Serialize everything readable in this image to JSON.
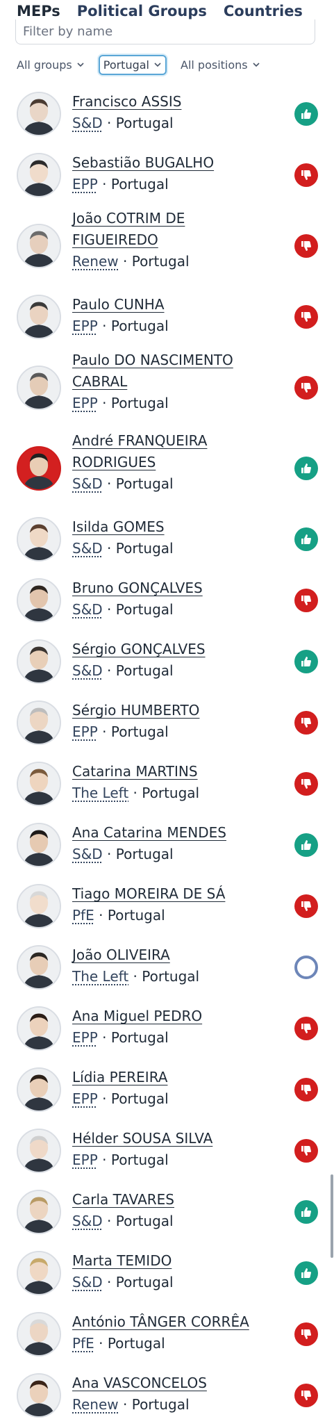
{
  "tabs": [
    {
      "label": "MEPs"
    },
    {
      "label": "Political Groups"
    },
    {
      "label": "Countries"
    }
  ],
  "filter": {
    "placeholder": "Filter by name"
  },
  "dropdowns": {
    "group": "All groups",
    "country": "Portugal",
    "position": "All positions"
  },
  "meps": [
    {
      "name_lines": [
        "Francisco ASSIS"
      ],
      "group": "S&D",
      "country": "Portugal",
      "vote": "for"
    },
    {
      "name_lines": [
        "Sebastião BUGALHO"
      ],
      "group": "EPP",
      "country": "Portugal",
      "vote": "against"
    },
    {
      "name_lines": [
        "João COTRIM DE",
        "FIGUEIREDO"
      ],
      "group": "Renew",
      "country": "Portugal",
      "vote": "against"
    },
    {
      "name_lines": [
        "Paulo CUNHA"
      ],
      "group": "EPP",
      "country": "Portugal",
      "vote": "against"
    },
    {
      "name_lines": [
        "Paulo DO NASCIMENTO",
        "CABRAL"
      ],
      "group": "EPP",
      "country": "Portugal",
      "vote": "against"
    },
    {
      "name_lines": [
        "André FRANQUEIRA",
        "RODRIGUES"
      ],
      "group": "S&D",
      "country": "Portugal",
      "vote": "for"
    },
    {
      "name_lines": [
        "Isilda GOMES"
      ],
      "group": "S&D",
      "country": "Portugal",
      "vote": "for"
    },
    {
      "name_lines": [
        "Bruno GONÇALVES"
      ],
      "group": "S&D",
      "country": "Portugal",
      "vote": "against"
    },
    {
      "name_lines": [
        "Sérgio GONÇALVES"
      ],
      "group": "S&D",
      "country": "Portugal",
      "vote": "for"
    },
    {
      "name_lines": [
        "Sérgio HUMBERTO"
      ],
      "group": "EPP",
      "country": "Portugal",
      "vote": "against"
    },
    {
      "name_lines": [
        "Catarina MARTINS"
      ],
      "group": "The Left",
      "country": "Portugal",
      "vote": "against"
    },
    {
      "name_lines": [
        "Ana Catarina MENDES"
      ],
      "group": "S&D",
      "country": "Portugal",
      "vote": "for"
    },
    {
      "name_lines": [
        "Tiago MOREIRA DE SÁ"
      ],
      "group": "PfE",
      "country": "Portugal",
      "vote": "against"
    },
    {
      "name_lines": [
        "João OLIVEIRA"
      ],
      "group": "The Left",
      "country": "Portugal",
      "vote": "abstain"
    },
    {
      "name_lines": [
        "Ana Miguel PEDRO"
      ],
      "group": "EPP",
      "country": "Portugal",
      "vote": "against"
    },
    {
      "name_lines": [
        "Lídia PEREIRA"
      ],
      "group": "EPP",
      "country": "Portugal",
      "vote": "against"
    },
    {
      "name_lines": [
        "Hélder SOUSA SILVA"
      ],
      "group": "EPP",
      "country": "Portugal",
      "vote": "against"
    },
    {
      "name_lines": [
        "Carla TAVARES"
      ],
      "group": "S&D",
      "country": "Portugal",
      "vote": "for"
    },
    {
      "name_lines": [
        "Marta TEMIDO"
      ],
      "group": "S&D",
      "country": "Portugal",
      "vote": "for"
    },
    {
      "name_lines": [
        "António TÂNGER CORRÊA"
      ],
      "group": "PfE",
      "country": "Portugal",
      "vote": "against"
    },
    {
      "name_lines": [
        "Ana VASCONCELOS"
      ],
      "group": "Renew",
      "country": "Portugal",
      "vote": "against"
    }
  ],
  "colors": {
    "for": "#16a085",
    "against": "#d21e1e",
    "abstain": "#6d86b8"
  },
  "icons": {
    "for": "thumbs-up-icon",
    "against": "thumbs-down-icon",
    "abstain": "circle-icon"
  }
}
